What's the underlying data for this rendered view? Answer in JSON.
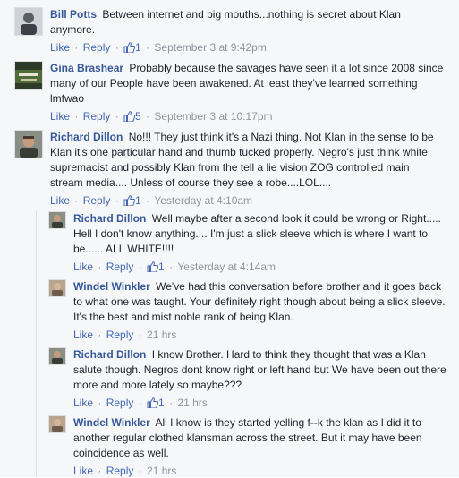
{
  "comments": [
    {
      "author": "Bill Potts",
      "text": "Between internet and big mouths...nothing is secret about Klan anymore.",
      "like_label": "Like",
      "reply_label": "Reply",
      "likes": "1",
      "time": "September 3 at 9:42pm"
    },
    {
      "author": "Gina Brashear",
      "text": "Probably because the savages have seen it a lot since 2008 since many of our People have been awakened. At least they've learned something lmfwao",
      "like_label": "Like",
      "reply_label": "Reply",
      "likes": "5",
      "time": "September 3 at 10:17pm"
    },
    {
      "author": "Richard Dillon",
      "text": "No!!! They just think it's a Nazi thing. Not Klan in the sense to be Klan it's one particular hand and thumb tucked properly. Negro's just think white supremacist and possibly Klan from the tell a lie vision ZOG controlled main stream media.... Unless of course they see a robe....LOL....",
      "like_label": "Like",
      "reply_label": "Reply",
      "likes": "1",
      "time": "Yesterday at 4:10am"
    }
  ],
  "replies": [
    {
      "author": "Richard Dillon",
      "text": "Well maybe after a second look it could be wrong or Right..... Hell I don't know anything.... I'm just a slick sleeve which is where I want to be...... ALL WHITE!!!!",
      "like_label": "Like",
      "reply_label": "Reply",
      "likes": "1",
      "time": "Yesterday at 4:14am"
    },
    {
      "author": "Windel Winkler",
      "text": "We've had this conversation before brother and it goes back to what one was taught. Your definitely right though about being a slick sleeve. It's the best and mist noble rank of being Klan.",
      "like_label": "Like",
      "reply_label": "Reply",
      "time": "21 hrs"
    },
    {
      "author": "Richard Dillon",
      "text": "I know Brother. Hard to think they thought that was a Klan salute though. Negros dont know right or left hand but We have been out there more and more lately so maybe???",
      "like_label": "Like",
      "reply_label": "Reply",
      "likes": "1",
      "time": "21 hrs"
    },
    {
      "author": "Windel Winkler",
      "text": "All I know is they started yelling f--k the klan as I did it to another regular clothed klansman across the street. But it may have been coincidence as well.",
      "like_label": "Like",
      "reply_label": "Reply",
      "time": "21 hrs"
    }
  ],
  "colors": {
    "name": "#365899",
    "link": "#4267b2",
    "meta": "#90949c",
    "text": "#1d2129",
    "bg": "#f6f7f9"
  },
  "icons": {
    "like": "thumbs-up-icon",
    "avatar": "profile-photo"
  }
}
